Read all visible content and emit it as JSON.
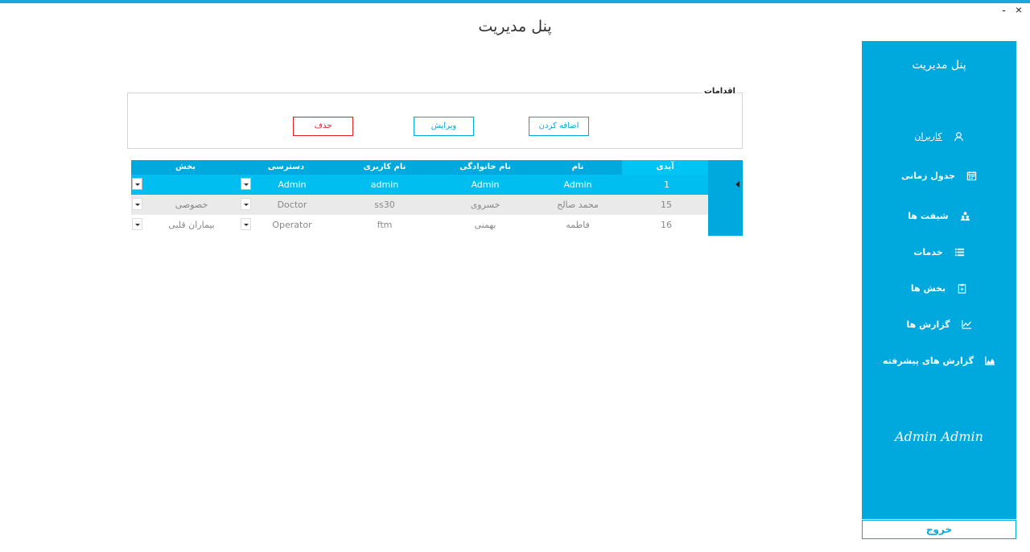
{
  "window": {
    "title": "پنل مدیریت",
    "minimize_label": "-",
    "close_label": "×"
  },
  "sidebar": {
    "title": "پنل مدیریت",
    "items": [
      {
        "label": "کاربران",
        "icon": "user-icon"
      },
      {
        "label": "جدول زمانی",
        "icon": "calendar-icon"
      },
      {
        "label": "شیفت ها",
        "icon": "people-icon"
      },
      {
        "label": "خدمات",
        "icon": "list-icon"
      },
      {
        "label": "بخش ها",
        "icon": "clipboard-icon"
      },
      {
        "label": "گزارش ها",
        "icon": "line-chart-icon"
      },
      {
        "label": "گزارش های پیشرفته",
        "icon": "area-chart-icon"
      }
    ],
    "user_name": "Admin Admin",
    "logout_label": "خروج"
  },
  "actions": {
    "legend": "اقدامات",
    "add_label": "اضافه کردن",
    "edit_label": "ویرایش",
    "delete_label": "حذف"
  },
  "grid": {
    "columns": [
      "آیدی",
      "نام",
      "نام خانوادگی",
      "نام کاربری",
      "دسترسی",
      "بخش"
    ],
    "rows": [
      {
        "id": "1",
        "first_name": "Admin",
        "last_name": "Admin",
        "username": "admin",
        "access": "Admin",
        "section": ""
      },
      {
        "id": "15",
        "first_name": "محمد صالح",
        "last_name": "خسروی",
        "username": "ss30",
        "access": "Doctor",
        "section": "خصوصی"
      },
      {
        "id": "16",
        "first_name": "فاطمه",
        "last_name": "بهمنی",
        "username": "ftm",
        "access": "Operator",
        "section": "بیماران قلبی"
      }
    ]
  },
  "colors": {
    "accent": "#00a9dd",
    "selected_row": "#00bff0",
    "delete": "#e02020"
  }
}
